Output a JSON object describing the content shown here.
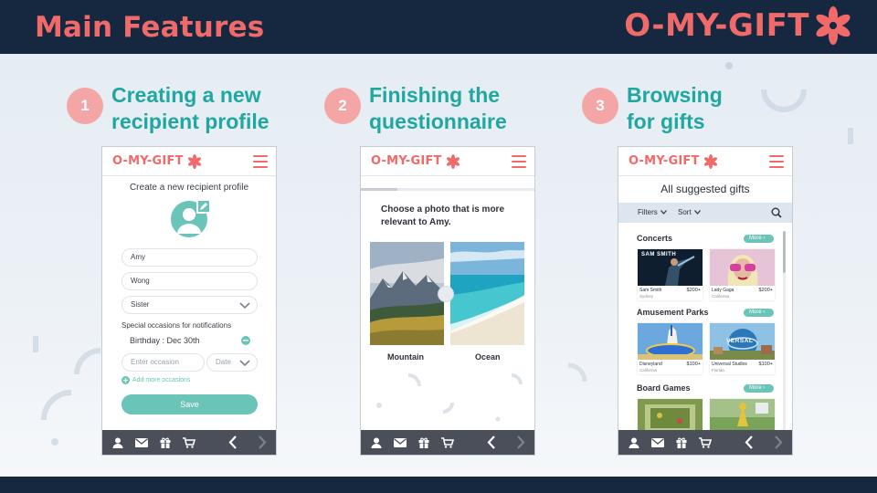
{
  "header": {
    "title": "Main Features",
    "brand": "O-MY-GIFT"
  },
  "steps": [
    {
      "number": "1",
      "title": "Creating a new recipient profile"
    },
    {
      "number": "2",
      "title": "Finishing the questionnaire"
    },
    {
      "number": "3",
      "title": "Browsing for gifts"
    }
  ],
  "phone": {
    "brand": "O-MY-GIFT"
  },
  "profile_screen": {
    "title": "Create a new recipient profile",
    "first_name": "Amy",
    "last_name": "Wong",
    "relationship": "Sister",
    "occasions_label": "Special occasions for notifications",
    "occasion": "Birthday : Dec 30th",
    "occasion_placeholder": "Enter occasion",
    "date_placeholder": "Date",
    "add_more": "Add more occasions",
    "save": "Save"
  },
  "questionnaire_screen": {
    "progress": 0.21,
    "question": "Choose a photo that is more relevant to Amy.",
    "option_a": "Mountain",
    "option_b": "Ocean"
  },
  "browse_screen": {
    "title": "All suggested gifts",
    "filters": "Filters",
    "sort": "Sort",
    "more": "More",
    "categories": [
      {
        "name": "Concerts",
        "items": [
          {
            "banner": "SAM SMITH",
            "name": "Sam Smith",
            "price": "$200+",
            "location": "Sydney"
          },
          {
            "name": "Lady Gaga",
            "price": "$200+",
            "location": "California"
          }
        ]
      },
      {
        "name": "Amusement Parks",
        "items": [
          {
            "name": "Disneyland",
            "price": "$100+",
            "location": "California"
          },
          {
            "banner": "VERSAL",
            "name": "Universal Studios",
            "price": "$100+",
            "location": "Florida"
          }
        ]
      },
      {
        "name": "Board Games",
        "items": [
          {},
          {}
        ]
      }
    ]
  },
  "colors": {
    "navy": "#16283f",
    "coral": "#f06a6a",
    "teal": "#1fa7a0",
    "mint": "#6ac4b7",
    "step_badge": "#f4a6a6",
    "nav_bar": "#4a4f5a"
  }
}
